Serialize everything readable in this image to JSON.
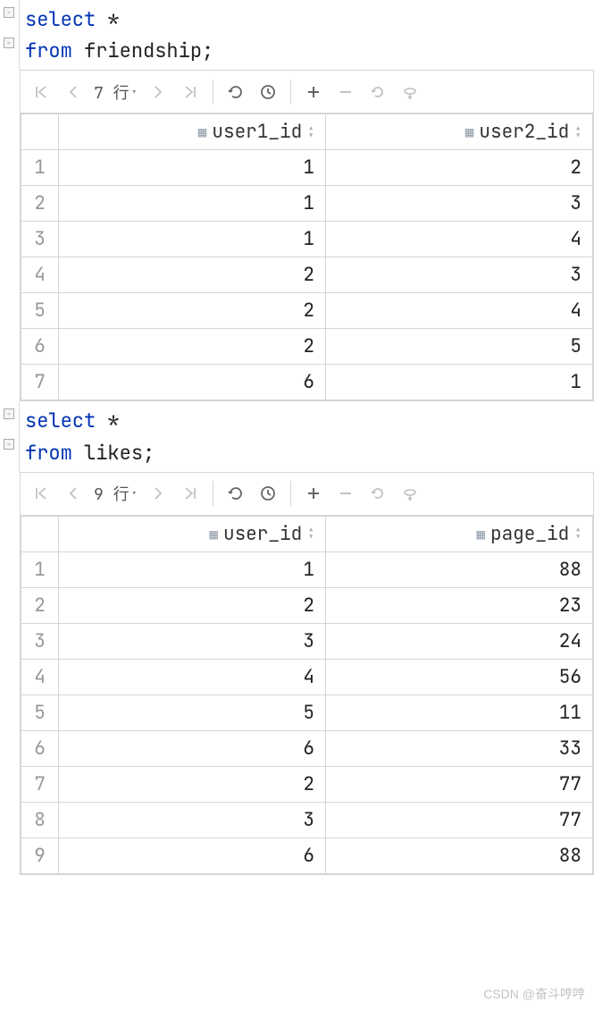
{
  "sql1": {
    "line1_kw": "select",
    "line1_rest": " *",
    "line2_kw": "from",
    "line2_rest": " friendship;"
  },
  "toolbar1": {
    "rows_label": "7 行"
  },
  "table1": {
    "headers": [
      "user1_id",
      "user2_id"
    ],
    "rows": [
      {
        "n": "1",
        "a": "1",
        "b": "2"
      },
      {
        "n": "2",
        "a": "1",
        "b": "3"
      },
      {
        "n": "3",
        "a": "1",
        "b": "4"
      },
      {
        "n": "4",
        "a": "2",
        "b": "3"
      },
      {
        "n": "5",
        "a": "2",
        "b": "4"
      },
      {
        "n": "6",
        "a": "2",
        "b": "5"
      },
      {
        "n": "7",
        "a": "6",
        "b": "1"
      }
    ]
  },
  "sql2": {
    "line1_kw": "select",
    "line1_rest": " *",
    "line2_kw": "from",
    "line2_rest": " likes;"
  },
  "toolbar2": {
    "rows_label": "9 行"
  },
  "table2": {
    "headers": [
      "user_id",
      "page_id"
    ],
    "rows": [
      {
        "n": "1",
        "a": "1",
        "b": "88"
      },
      {
        "n": "2",
        "a": "2",
        "b": "23"
      },
      {
        "n": "3",
        "a": "3",
        "b": "24"
      },
      {
        "n": "4",
        "a": "4",
        "b": "56"
      },
      {
        "n": "5",
        "a": "5",
        "b": "11"
      },
      {
        "n": "6",
        "a": "6",
        "b": "33"
      },
      {
        "n": "7",
        "a": "2",
        "b": "77"
      },
      {
        "n": "8",
        "a": "3",
        "b": "77"
      },
      {
        "n": "9",
        "a": "6",
        "b": "88"
      }
    ]
  },
  "watermark": "CSDN @奋斗哼哼"
}
